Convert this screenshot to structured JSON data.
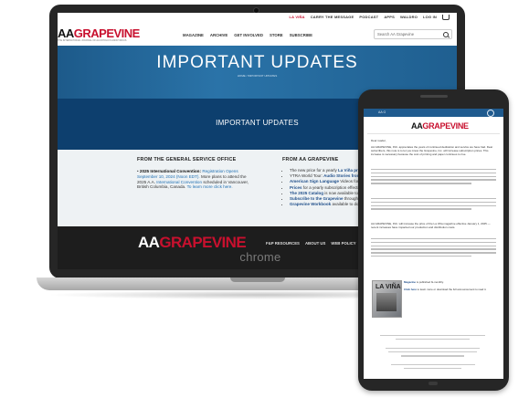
{
  "laptop": {
    "topbar": {
      "la_vina": "LA VIÑA",
      "links": [
        "CARRY THE MESSAGE",
        "PODCAST",
        "APPS",
        "WALDRO",
        "LOG IN"
      ]
    },
    "logo": {
      "aa": "AA",
      "grapevine": "GRAPEVINE",
      "tagline": "THE INTERNATIONAL JOURNAL OF ALCOHOLICS ANONYMOUS"
    },
    "nav": [
      "MAGAZINE",
      "ARCHIVE",
      "GET INVOLVED",
      "STORE",
      "SUBSCRIBE"
    ],
    "search": {
      "placeholder": "Search AA Grapevine"
    },
    "hero": {
      "title": "IMPORTANT UPDATES",
      "breadcrumb": "HOME / IMPORTANT UPDATES"
    },
    "band": {
      "title": "IMPORTANT UPDATES"
    },
    "col1": {
      "heading": "FROM THE GENERAL SERVICE OFFICE",
      "bold": "2025 International Convention:",
      "link1": "Registration Opens September 10, 2024 (Noon EDT).",
      "text": "More plans to attend the 2025 A.A.",
      "link2": "International Convention",
      "text2": "scheduled in Vancouver, British Columbia, Canada.",
      "link3": "To learn more click here."
    },
    "col2": {
      "heading": "FROM AA GRAPEVINE",
      "items": [
        {
          "pre": "The new price for a yearly ",
          "link": "La Viña print",
          "post": " $18.00, effective January 1, 2025"
        },
        {
          "pre": "YTRA World Tour: ",
          "link": "Audio Stories from You",
          "post": ""
        },
        {
          "pre": "",
          "link": "American Sign Language",
          "post": " Videos for De"
        },
        {
          "pre": "",
          "link": "Prices",
          "post": " for a yearly subscription effective"
        },
        {
          "pre": "",
          "link": "The 2025 Catalog",
          "post": " is now available to do"
        },
        {
          "pre": "",
          "link": "Subscribe to the Grapevine",
          "post": " through the"
        },
        {
          "pre": "",
          "link": "Grapevine Workbook",
          "post": " available to down"
        }
      ]
    },
    "footer": {
      "aa": "AA",
      "grapevine": "GRAPEVINE",
      "links": [
        "F&P RESOURCES",
        "ABOUT US",
        "WEB POLICY",
        "CONT"
      ]
    },
    "chrome_label": "chrome"
  },
  "phone": {
    "status_left": "AA G",
    "logo": {
      "aa": "AA",
      "grapevine": "GRAPEVINE"
    },
    "intro_label": "Dear reader,",
    "para1": "AA GRAPEVINE, INC. appreciates the years of continued dedication and service we have had. Dear subscribers, this note is to let you know the Grapevine, Inc. will increase subscription prices. This increase is necessary because the cost of printing and paper continues to rise.",
    "para2": "AA GRAPEVINE, INC. will increase the price of the La Viña magazine effective January 1, 2025 — recent increases have impacted our production and distribution costs.",
    "book_label": "LA VIÑA",
    "book_link1": "Magazine",
    "book_text1": "is published bi-monthly.",
    "book_link2": "Click here",
    "book_text2": "to learn more or download the full announcement to read it."
  },
  "colors": {
    "brand_red": "#c8102e",
    "hero_blue": "#2a73a8",
    "band_navy": "#0d3f6e",
    "footer_dark": "#1d1d1d",
    "device_frame": "#262626"
  },
  "icons": [
    "search-icon",
    "cart-icon",
    "camera-icon",
    "speaker-icon"
  ]
}
